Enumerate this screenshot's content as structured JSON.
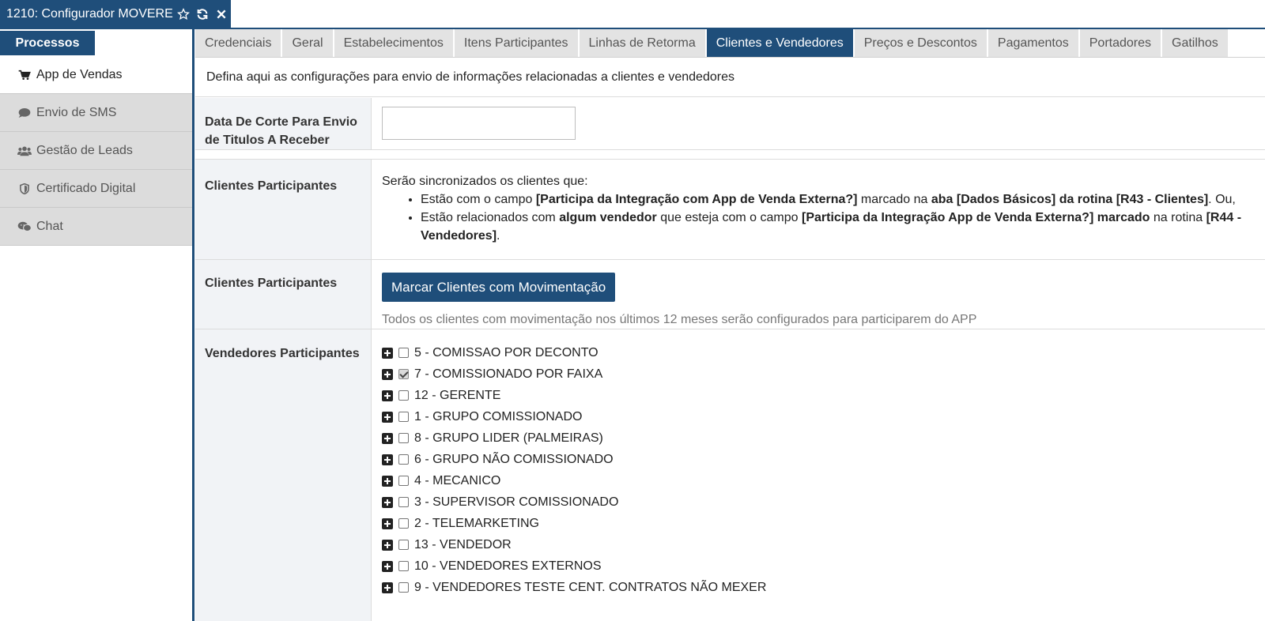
{
  "window": {
    "title": "1210: Configurador MOVERE",
    "icons": [
      "star-icon",
      "refresh-icon",
      "close-icon"
    ]
  },
  "sidebar": {
    "section_button": "Processos",
    "items": [
      {
        "label": "App de Vendas",
        "icon": "cart-icon",
        "active": true
      },
      {
        "label": "Envio de SMS",
        "icon": "comment-icon",
        "active": false
      },
      {
        "label": "Gestão de Leads",
        "icon": "users-icon",
        "active": false
      },
      {
        "label": "Certificado Digital",
        "icon": "shield-icon",
        "active": false
      },
      {
        "label": "Chat",
        "icon": "chat-icon",
        "active": false
      }
    ]
  },
  "tabs": [
    {
      "label": "Credenciais"
    },
    {
      "label": "Geral"
    },
    {
      "label": "Estabelecimentos"
    },
    {
      "label": "Itens Participantes"
    },
    {
      "label": "Linhas de Retorma"
    },
    {
      "label": "Clientes e Vendedores",
      "active": true
    },
    {
      "label": "Preços e Descontos"
    },
    {
      "label": "Pagamentos"
    },
    {
      "label": "Portadores"
    },
    {
      "label": "Gatilhos"
    }
  ],
  "content": {
    "intro": "Defina aqui as configurações para envio de informações relacionadas a clientes e vendedores",
    "cutoff": {
      "label": "Data De Corte Para Envio de Titulos A Receber",
      "value": ""
    },
    "rules": {
      "label": "Clientes Participantes",
      "lead": "Serão sincronizados os clientes que:",
      "item1": {
        "a": "Estão com o campo ",
        "b": "[Participa da Integração com App de Venda Externa?]",
        "c": " marcado na ",
        "d": "aba [Dados Básicos] da rotina [R43 - Clientes]",
        "e": ". Ou,"
      },
      "item2": {
        "a": "Estão relacionados com ",
        "b": "algum vendedor",
        "c": " que esteja com o campo ",
        "d": "[Participa da Integração App de Venda Externa?] marcado",
        "e": " na rotina ",
        "f": "[R44 -",
        "g": "Vendedores]",
        "h": "."
      }
    },
    "mark": {
      "label": "Clientes Participantes",
      "button": "Marcar Clientes com Movimentação",
      "hint": "Todos os clientes com movimentação nos últimos 12 meses serão configurados para participarem do APP"
    },
    "vendors": {
      "label": "Vendedores Participantes",
      "items": [
        {
          "label": "5 - COMISSAO POR DECONTO",
          "checked": false
        },
        {
          "label": "7 - COMISSIONADO POR FAIXA",
          "checked": true
        },
        {
          "label": "12 - GERENTE",
          "checked": false
        },
        {
          "label": "1 - GRUPO COMISSIONADO",
          "checked": false
        },
        {
          "label": "8 - GRUPO LIDER (PALMEIRAS)",
          "checked": false
        },
        {
          "label": "6 - GRUPO NÃO COMISSIONADO",
          "checked": false
        },
        {
          "label": "4 - MECANICO",
          "checked": false
        },
        {
          "label": "3 - SUPERVISOR COMISSIONADO",
          "checked": false
        },
        {
          "label": "2 - TELEMARKETING",
          "checked": false
        },
        {
          "label": "13 - VENDEDOR",
          "checked": false
        },
        {
          "label": "10 - VENDEDORES EXTERNOS",
          "checked": false
        },
        {
          "label": "9 - VENDEDORES TESTE CENT. CONTRATOS NÃO MEXER",
          "checked": false
        }
      ]
    }
  },
  "colors": {
    "primary": "#1f4e7a",
    "sidebar_bg": "#dcdcdc",
    "tab_bg": "#e3e3e3",
    "label_bg": "#f1f3f6"
  }
}
